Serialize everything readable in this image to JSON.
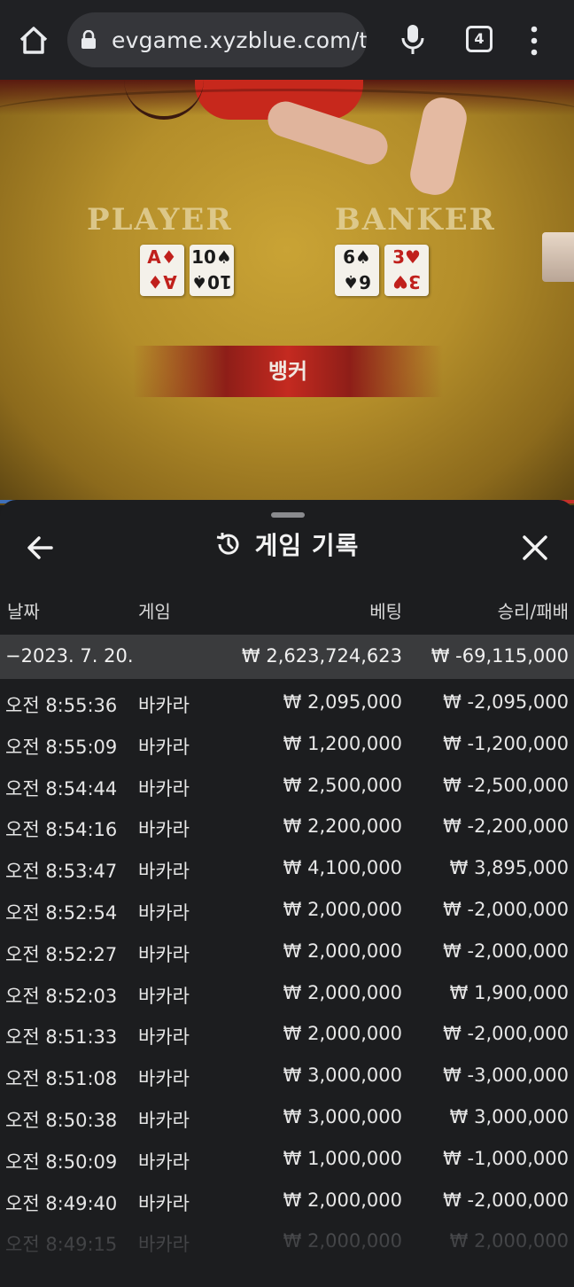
{
  "browser": {
    "url": "evgame.xyzblue.com/t",
    "tab_count": "4",
    "icons": [
      "home-icon",
      "lock-icon",
      "mic-icon",
      "tab-switcher-icon",
      "more-vert-icon"
    ]
  },
  "game": {
    "player_label": "PLAYER",
    "banker_label": "BANKER",
    "player_cards": [
      {
        "rank": "A",
        "suit": "♦",
        "color": "#c0201c"
      },
      {
        "rank": "10",
        "suit": "♠",
        "color": "#1a1a1a"
      }
    ],
    "banker_cards": [
      {
        "rank": "6",
        "suit": "♠",
        "color": "#1a1a1a"
      },
      {
        "rank": "3",
        "suit": "♥",
        "color": "#c0201c"
      }
    ],
    "result": "뱅커",
    "player_color": "#3f6fb8",
    "banker_color": "#c4302a"
  },
  "history": {
    "title": "게임 기록",
    "icons": [
      "back-arrow-icon",
      "history-icon",
      "close-icon"
    ],
    "columns": {
      "date": "날짜",
      "game": "게임",
      "bet": "베팅",
      "result": "승리/패배"
    },
    "summary": {
      "date": "−2023. 7. 20.",
      "bet": "₩ 2,623,724,623",
      "result": "₩ -69,115,000"
    },
    "rows": [
      {
        "time": "오전 8:55:36",
        "game": "바카라",
        "bet": "₩ 2,095,000",
        "result": "₩ -2,095,000"
      },
      {
        "time": "오전 8:55:09",
        "game": "바카라",
        "bet": "₩ 1,200,000",
        "result": "₩ -1,200,000"
      },
      {
        "time": "오전 8:54:44",
        "game": "바카라",
        "bet": "₩ 2,500,000",
        "result": "₩ -2,500,000"
      },
      {
        "time": "오전 8:54:16",
        "game": "바카라",
        "bet": "₩ 2,200,000",
        "result": "₩ -2,200,000"
      },
      {
        "time": "오전 8:53:47",
        "game": "바카라",
        "bet": "₩ 4,100,000",
        "result": "₩ 3,895,000"
      },
      {
        "time": "오전 8:52:54",
        "game": "바카라",
        "bet": "₩ 2,000,000",
        "result": "₩ -2,000,000"
      },
      {
        "time": "오전 8:52:27",
        "game": "바카라",
        "bet": "₩ 2,000,000",
        "result": "₩ -2,000,000"
      },
      {
        "time": "오전 8:52:03",
        "game": "바카라",
        "bet": "₩ 2,000,000",
        "result": "₩ 1,900,000"
      },
      {
        "time": "오전 8:51:33",
        "game": "바카라",
        "bet": "₩ 2,000,000",
        "result": "₩ -2,000,000"
      },
      {
        "time": "오전 8:51:08",
        "game": "바카라",
        "bet": "₩ 3,000,000",
        "result": "₩ -3,000,000"
      },
      {
        "time": "오전 8:50:38",
        "game": "바카라",
        "bet": "₩ 3,000,000",
        "result": "₩ 3,000,000"
      },
      {
        "time": "오전 8:50:09",
        "game": "바카라",
        "bet": "₩ 1,000,000",
        "result": "₩ -1,000,000"
      },
      {
        "time": "오전 8:49:40",
        "game": "바카라",
        "bet": "₩ 2,000,000",
        "result": "₩ -2,000,000"
      },
      {
        "time": "오전 8:49:15",
        "game": "바카라",
        "bet": "₩ 2,000,000",
        "result": "₩ 2,000,000"
      }
    ]
  }
}
